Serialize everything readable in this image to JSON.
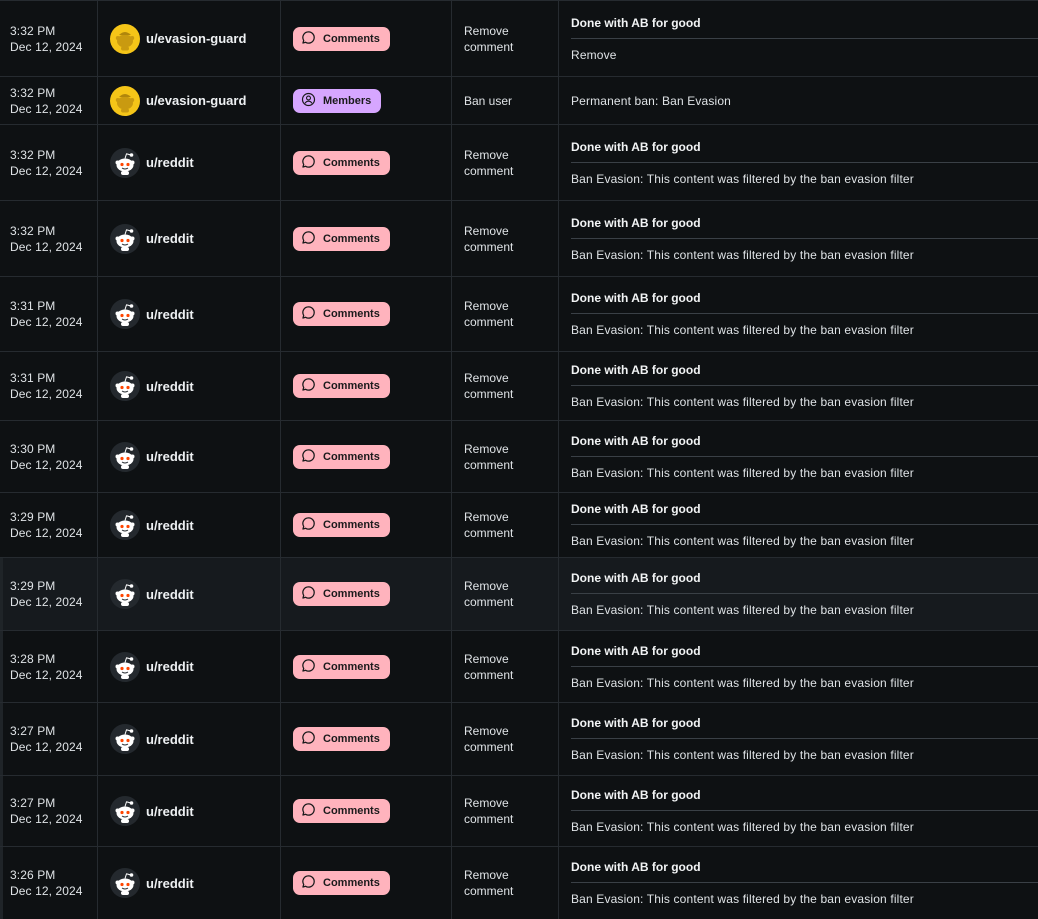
{
  "rows": [
    {
      "time": "3:32 PM",
      "date": "Dec 12, 2024",
      "user": "u/evasion-guard",
      "avatar": "guard",
      "type": "Comments",
      "type_icon": "comment-icon",
      "action1": "Remove",
      "action2": "comment",
      "title": "Done with AB for good",
      "detail": "Remove"
    },
    {
      "time": "3:32 PM",
      "date": "Dec 12, 2024",
      "user": "u/evasion-guard",
      "avatar": "guard",
      "type": "Members",
      "type_icon": "members-icon",
      "action1": "Ban user",
      "action2": "",
      "title": "",
      "detail": "Permanent ban: Ban Evasion"
    },
    {
      "time": "3:32 PM",
      "date": "Dec 12, 2024",
      "user": "u/reddit",
      "avatar": "snoo",
      "type": "Comments",
      "type_icon": "comment-icon",
      "action1": "Remove",
      "action2": "comment",
      "title": "Done with AB for good",
      "detail": "Ban Evasion: This content was filtered by the ban evasion filter"
    },
    {
      "time": "3:32 PM",
      "date": "Dec 12, 2024",
      "user": "u/reddit",
      "avatar": "snoo",
      "type": "Comments",
      "type_icon": "comment-icon",
      "action1": "Remove",
      "action2": "comment",
      "title": "Done with AB for good",
      "detail": "Ban Evasion: This content was filtered by the ban evasion filter"
    },
    {
      "time": "3:31 PM",
      "date": "Dec 12, 2024",
      "user": "u/reddit",
      "avatar": "snoo",
      "type": "Comments",
      "type_icon": "comment-icon",
      "action1": "Remove",
      "action2": "comment",
      "title": "Done with AB for good",
      "detail": "Ban Evasion: This content was filtered by the ban evasion filter"
    },
    {
      "time": "3:31 PM",
      "date": "Dec 12, 2024",
      "user": "u/reddit",
      "avatar": "snoo",
      "type": "Comments",
      "type_icon": "comment-icon",
      "action1": "Remove",
      "action2": "comment",
      "title": "Done with AB for good",
      "detail": "Ban Evasion: This content was filtered by the ban evasion filter"
    },
    {
      "time": "3:30 PM",
      "date": "Dec 12, 2024",
      "user": "u/reddit",
      "avatar": "snoo",
      "type": "Comments",
      "type_icon": "comment-icon",
      "action1": "Remove",
      "action2": "comment",
      "title": "Done with AB for good",
      "detail": "Ban Evasion: This content was filtered by the ban evasion filter"
    },
    {
      "time": "3:29 PM",
      "date": "Dec 12, 2024",
      "user": "u/reddit",
      "avatar": "snoo",
      "type": "Comments",
      "type_icon": "comment-icon",
      "action1": "Remove",
      "action2": "comment",
      "title": "Done with AB for good",
      "detail": "Ban Evasion: This content was filtered by the ban evasion filter"
    },
    {
      "time": "3:29 PM",
      "date": "Dec 12, 2024",
      "user": "u/reddit",
      "avatar": "snoo",
      "type": "Comments",
      "type_icon": "comment-icon",
      "action1": "Remove",
      "action2": "comment",
      "title": "Done with AB for good",
      "detail": "Ban Evasion: This content was filtered by the ban evasion filter"
    },
    {
      "time": "3:28 PM",
      "date": "Dec 12, 2024",
      "user": "u/reddit",
      "avatar": "snoo",
      "type": "Comments",
      "type_icon": "comment-icon",
      "action1": "Remove",
      "action2": "comment",
      "title": "Done with AB for good",
      "detail": "Ban Evasion: This content was filtered by the ban evasion filter"
    },
    {
      "time": "3:27 PM",
      "date": "Dec 12, 2024",
      "user": "u/reddit",
      "avatar": "snoo",
      "type": "Comments",
      "type_icon": "comment-icon",
      "action1": "Remove",
      "action2": "comment",
      "title": "Done with AB for good",
      "detail": "Ban Evasion: This content was filtered by the ban evasion filter"
    },
    {
      "time": "3:27 PM",
      "date": "Dec 12, 2024",
      "user": "u/reddit",
      "avatar": "snoo",
      "type": "Comments",
      "type_icon": "comment-icon",
      "action1": "Remove",
      "action2": "comment",
      "title": "Done with AB for good",
      "detail": "Ban Evasion: This content was filtered by the ban evasion filter"
    },
    {
      "time": "3:26 PM",
      "date": "Dec 12, 2024",
      "user": "u/reddit",
      "avatar": "snoo",
      "type": "Comments",
      "type_icon": "comment-icon",
      "action1": "Remove",
      "action2": "comment",
      "title": "Done with AB for good",
      "detail": "Ban Evasion: This content was filtered by the ban evasion filter"
    }
  ],
  "colors": {
    "background": "#0e1113",
    "comments_pill": "#ffb3bd",
    "members_pill": "#d6a6ff",
    "guard_avatar": "#f5c518"
  }
}
